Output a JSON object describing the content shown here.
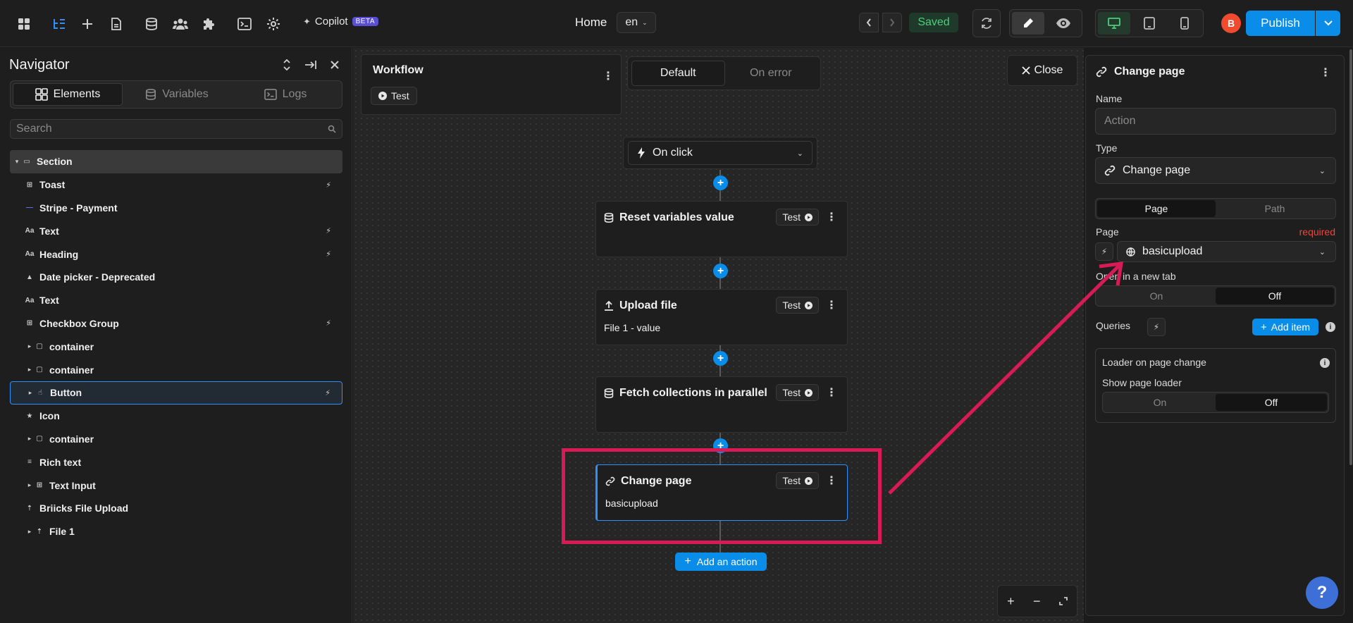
{
  "topbar": {
    "copilot_label": "Copilot",
    "beta_label": "BETA",
    "page_name": "Home",
    "language": "en",
    "saved_label": "Saved",
    "avatar_initial": "B",
    "publish_label": "Publish"
  },
  "navigator": {
    "title": "Navigator",
    "tabs": [
      {
        "label": "Elements",
        "icon": "grid-icon",
        "selected": true
      },
      {
        "label": "Variables",
        "icon": "database-icon",
        "selected": false
      },
      {
        "label": "Logs",
        "icon": "terminal-icon",
        "selected": false
      }
    ],
    "search_placeholder": "Search",
    "tree": [
      {
        "label": "Section",
        "icon": "section-icon",
        "caret": "open",
        "level": 0,
        "state": "section",
        "right_icon": ""
      },
      {
        "label": "Toast",
        "icon": "grid-icon",
        "caret": "",
        "level": 1,
        "state": "",
        "right_icon": "lightning-icon"
      },
      {
        "label": "Stripe - Payment",
        "icon": "line-icon",
        "caret": "",
        "level": 1,
        "state": "",
        "right_icon": ""
      },
      {
        "label": "Text",
        "icon": "text-icon",
        "caret": "",
        "level": 1,
        "state": "",
        "right_icon": "unplug-icon"
      },
      {
        "label": "Heading",
        "icon": "text-icon",
        "caret": "",
        "level": 1,
        "state": "",
        "right_icon": "unplug-icon"
      },
      {
        "label": "Date picker - Deprecated",
        "icon": "warning-icon",
        "caret": "",
        "level": 1,
        "state": "",
        "right_icon": ""
      },
      {
        "label": "Text",
        "icon": "text-icon",
        "caret": "",
        "level": 1,
        "state": "",
        "right_icon": ""
      },
      {
        "label": "Checkbox Group",
        "icon": "grid-icon",
        "caret": "",
        "level": 1,
        "state": "",
        "right_icon": "unplug-icon"
      },
      {
        "label": "container",
        "icon": "square-icon",
        "caret": "closed",
        "level": 1,
        "state": "",
        "right_icon": ""
      },
      {
        "label": "container",
        "icon": "square-icon",
        "caret": "closed",
        "level": 1,
        "state": "",
        "right_icon": ""
      },
      {
        "label": "Button",
        "icon": "pointer-icon",
        "caret": "closed",
        "level": 1,
        "state": "selected",
        "right_icon": "lightning-icon"
      },
      {
        "label": "Icon",
        "icon": "star-icon",
        "caret": "",
        "level": 1,
        "state": "",
        "right_icon": ""
      },
      {
        "label": "container",
        "icon": "square-icon",
        "caret": "closed",
        "level": 1,
        "state": "",
        "right_icon": ""
      },
      {
        "label": "Rich text",
        "icon": "lines-icon",
        "caret": "",
        "level": 1,
        "state": "",
        "right_icon": ""
      },
      {
        "label": "Text Input",
        "icon": "grid-icon",
        "caret": "closed",
        "level": 1,
        "state": "",
        "right_icon": ""
      },
      {
        "label": "Briicks File Upload",
        "icon": "upload-icon",
        "caret": "",
        "level": 1,
        "state": "",
        "right_icon": ""
      },
      {
        "label": "File 1",
        "icon": "upload-icon",
        "caret": "closed",
        "level": 1,
        "state": "",
        "right_icon": ""
      }
    ]
  },
  "workflow": {
    "title": "Workflow",
    "test_label": "Test",
    "mode_tabs": [
      {
        "label": "Default",
        "selected": true
      },
      {
        "label": "On error",
        "selected": false
      }
    ],
    "close_label": "Close",
    "trigger_label": "On click",
    "actions": [
      {
        "title": "Reset variables value",
        "icon": "database-icon",
        "test_label": "Test",
        "subtitle": ""
      },
      {
        "title": "Upload file",
        "icon": "upload-icon",
        "test_label": "Test",
        "subtitle": "File 1 - value"
      },
      {
        "title": "Fetch collections in parallel",
        "icon": "database-icon",
        "test_label": "Test",
        "subtitle": ""
      },
      {
        "title": "Change page",
        "icon": "link-icon",
        "test_label": "Test",
        "subtitle": "basicupload"
      }
    ],
    "add_action_label": "Add an action"
  },
  "panel": {
    "title": "Change page",
    "name_label": "Name",
    "name_placeholder": "Action",
    "type_label": "Type",
    "type_value": "Change page",
    "target_tabs": [
      {
        "label": "Page",
        "selected": true
      },
      {
        "label": "Path",
        "selected": false
      }
    ],
    "page_label": "Page",
    "required_label": "required",
    "page_value": "basicupload",
    "new_tab_label": "Open in a new tab",
    "new_tab_options": [
      {
        "label": "On",
        "selected": false
      },
      {
        "label": "Off",
        "selected": true
      }
    ],
    "queries_label": "Queries",
    "add_item_label": "Add item",
    "loader_label": "Loader on page change",
    "show_loader_label": "Show page loader",
    "loader_options": [
      {
        "label": "On",
        "selected": false
      },
      {
        "label": "Off",
        "selected": true
      }
    ]
  },
  "help_label": "?",
  "colors": {
    "accent": "#0a8de8",
    "highlight": "#d81b56",
    "saved": "#4ad07a",
    "required": "#f04438"
  }
}
